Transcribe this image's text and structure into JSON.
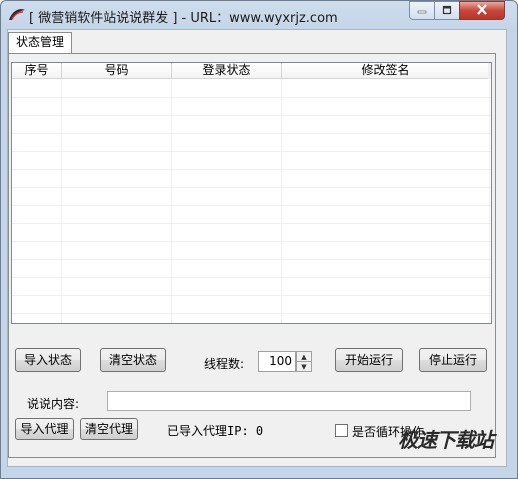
{
  "window": {
    "title": "[ 微营销软件站说说群发 ] - URL：www.wyxrjz.com"
  },
  "tabs": [
    {
      "label": "状态管理"
    }
  ],
  "table": {
    "columns": [
      "序号",
      "号码",
      "登录状态",
      "修改签名"
    ],
    "rows": []
  },
  "controls": {
    "import_status": "导入状态",
    "clear_status": "清空状态",
    "threads_label": "线程数:",
    "threads_value": "100",
    "start": "开始运行",
    "stop": "停止运行",
    "content_label": "说说内容:",
    "content_value": "",
    "import_proxy": "导入代理",
    "clear_proxy": "清空代理",
    "proxy_count_label": "已导入代理IP: 0",
    "loop_label": "是否循环操作",
    "loop_checked": false
  },
  "watermark": "极速下载站",
  "icons": {
    "app": "feather-logo-icon",
    "minimize": "minimize-icon",
    "maximize": "maximize-icon",
    "close": "close-icon",
    "spin_up": "spin-up-icon",
    "spin_down": "spin-down-icon"
  }
}
